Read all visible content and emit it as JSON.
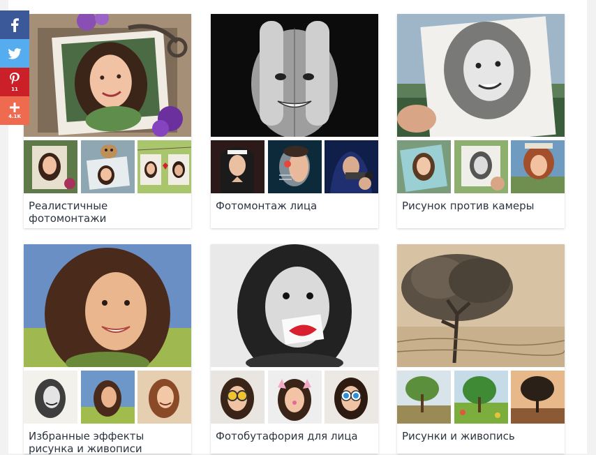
{
  "share": {
    "facebook_count": "",
    "twitter_count": "",
    "pinterest_count": "11",
    "more_count": "4.1K"
  },
  "cards": [
    {
      "title": "Реалистичные фотомонтажи"
    },
    {
      "title": "Фотомонтаж лица"
    },
    {
      "title": "Рисунок против камеры"
    },
    {
      "title": "Избранные эффекты рисунка и живописи"
    },
    {
      "title": "Фотобутафория для лица"
    },
    {
      "title": "Рисунки и живопись"
    }
  ],
  "icons": {
    "facebook": "facebook-icon",
    "twitter": "twitter-icon",
    "pinterest": "pinterest-icon",
    "more": "plus-icon"
  },
  "colors": {
    "facebook": "#3b5998",
    "twitter": "#55acee",
    "pinterest": "#cb2027",
    "more": "#ee6b50",
    "title_text": "#2c3440"
  }
}
